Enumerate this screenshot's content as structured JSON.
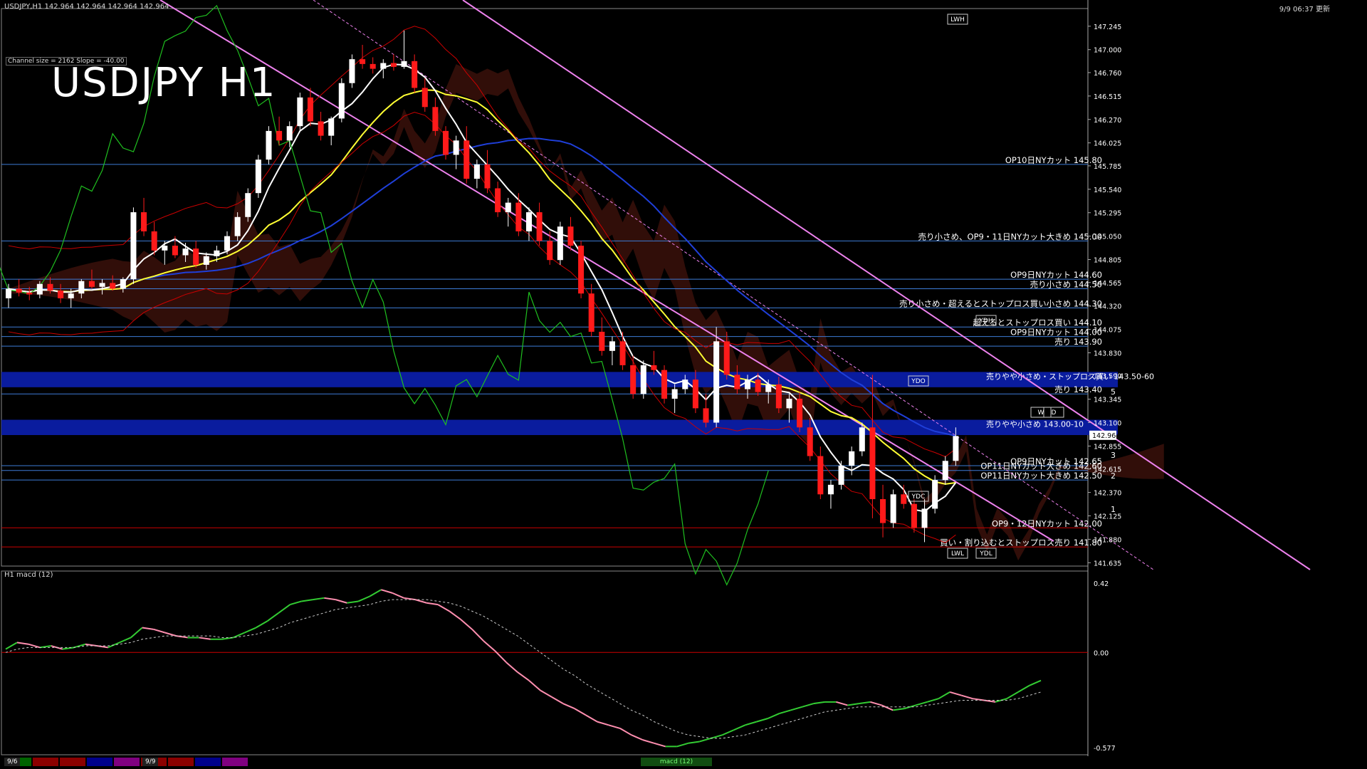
{
  "header": {
    "symbol_info": "USDJPY,H1  142.964 142.964 142.964 142.964",
    "datetime": "9/9 06:37 更新",
    "title": "USDJPY H1",
    "channel_info": "Channel size = 2162 Slope = -40.00"
  },
  "colors": {
    "background": "#000000",
    "bull": "#ffffff",
    "bear": "#ff1a1a",
    "level_line": "#3d7bd6",
    "zone": "#0a1c9e",
    "channel": "#ee82ee",
    "ma_fast": "#ffffff",
    "ma_mid": "#ffff33",
    "ma_slow": "#1f3fd9",
    "macd_up": "#33cc33",
    "macd_down": "#ff8fb0",
    "signal": "#cccccc"
  },
  "chart_data": {
    "type": "candlestick",
    "price_axis": {
      "ticks": [
        "147.245",
        "147.000",
        "146.760",
        "146.515",
        "146.270",
        "146.025",
        "145.785",
        "145.540",
        "145.295",
        "145.050",
        "144.805",
        "144.565",
        "144.320",
        "144.075",
        "143.830",
        "143.590",
        "143.345",
        "143.100",
        "142.855",
        "142.615",
        "142.370",
        "142.125",
        "141.880",
        "141.635"
      ],
      "ylim": [
        141.6,
        147.4
      ],
      "current_price": "142.964"
    },
    "levels": [
      {
        "label": "OP10日NYカット 145.80",
        "price": 145.8
      },
      {
        "label": "売り小さめ、OP9・11日NYカット大きめ 145.00",
        "price": 145.0
      },
      {
        "label": "OP9日NYカット 144.60",
        "price": 144.6
      },
      {
        "label": "売り小さめ 144.50",
        "price": 144.5
      },
      {
        "label": "売り小さめ・超えるとストップロス買い小さめ 144.30",
        "price": 144.3
      },
      {
        "label": "超えるとストップロス買い 144.10",
        "price": 144.1
      },
      {
        "label": "OP9日NYカット 144.00",
        "price": 144.0
      },
      {
        "label": "売り 143.90",
        "price": 143.9
      },
      {
        "label": "売り 143.40",
        "price": 143.4
      },
      {
        "label": "OP9日NYカット 142.65",
        "price": 142.65
      },
      {
        "label": "OP11日NYカット大きめ 142.60",
        "price": 142.6
      },
      {
        "label": "OP11日NYカット大きめ 142.50",
        "price": 142.5
      },
      {
        "label": "OP9・12日NYカット 142.00",
        "price": 142.0
      },
      {
        "label": "買い・割り込むとストップロス売り 141.80",
        "price": 141.8
      }
    ],
    "zones": [
      {
        "label": "売りやや小さめ・ストップロス買い 143.50-60",
        "low": 143.5,
        "high": 143.6
      },
      {
        "label": "売りやや小さめ 143.00-10",
        "low": 143.0,
        "high": 143.1
      }
    ],
    "projection_labels": [
      "5",
      "3",
      "2",
      "1"
    ],
    "box_labels": [
      "YDO",
      "YDC",
      "YDH",
      "YDL",
      "LWH",
      "LWL",
      "W",
      "D"
    ],
    "candles": [
      [
        144.4,
        144.55,
        144.3,
        144.5
      ],
      [
        144.5,
        144.6,
        144.42,
        144.46
      ],
      [
        144.46,
        144.52,
        144.38,
        144.44
      ],
      [
        144.44,
        144.58,
        144.4,
        144.55
      ],
      [
        144.55,
        144.62,
        144.45,
        144.48
      ],
      [
        144.48,
        144.55,
        144.35,
        144.4
      ],
      [
        144.4,
        144.5,
        144.3,
        144.45
      ],
      [
        144.45,
        144.6,
        144.4,
        144.58
      ],
      [
        144.58,
        144.7,
        144.5,
        144.52
      ],
      [
        144.52,
        144.6,
        144.44,
        144.56
      ],
      [
        144.56,
        144.64,
        144.48,
        144.5
      ],
      [
        144.5,
        144.62,
        144.46,
        144.6
      ],
      [
        144.6,
        145.35,
        144.55,
        145.3
      ],
      [
        145.3,
        145.45,
        145.05,
        145.1
      ],
      [
        145.1,
        145.2,
        144.85,
        144.9
      ],
      [
        144.9,
        145.0,
        144.75,
        144.95
      ],
      [
        144.95,
        145.05,
        144.82,
        144.85
      ],
      [
        144.85,
        144.98,
        144.78,
        144.92
      ],
      [
        144.92,
        145.0,
        144.72,
        144.75
      ],
      [
        144.75,
        144.88,
        144.7,
        144.84
      ],
      [
        144.84,
        144.95,
        144.78,
        144.9
      ],
      [
        144.9,
        145.1,
        144.86,
        145.05
      ],
      [
        145.05,
        145.3,
        145.0,
        145.25
      ],
      [
        145.25,
        145.55,
        145.2,
        145.5
      ],
      [
        145.5,
        145.9,
        145.45,
        145.85
      ],
      [
        145.85,
        146.2,
        145.8,
        146.15
      ],
      [
        146.15,
        146.3,
        146.0,
        146.05
      ],
      [
        146.05,
        146.25,
        145.98,
        146.2
      ],
      [
        146.2,
        146.55,
        146.15,
        146.5
      ],
      [
        146.5,
        146.6,
        146.2,
        146.25
      ],
      [
        146.25,
        146.35,
        146.05,
        146.1
      ],
      [
        146.1,
        146.3,
        146.0,
        146.28
      ],
      [
        146.28,
        146.7,
        146.24,
        146.65
      ],
      [
        146.65,
        146.95,
        146.6,
        146.9
      ],
      [
        146.9,
        147.05,
        146.8,
        146.85
      ],
      [
        146.85,
        146.92,
        146.75,
        146.8
      ],
      [
        146.8,
        146.9,
        146.7,
        146.86
      ],
      [
        146.86,
        146.95,
        146.78,
        146.82
      ],
      [
        146.82,
        147.2,
        146.8,
        146.88
      ],
      [
        146.88,
        146.95,
        146.55,
        146.6
      ],
      [
        146.6,
        146.7,
        146.35,
        146.4
      ],
      [
        146.4,
        146.5,
        146.1,
        146.15
      ],
      [
        146.15,
        146.2,
        145.85,
        145.9
      ],
      [
        145.9,
        146.1,
        145.75,
        146.05
      ],
      [
        146.05,
        146.2,
        145.6,
        145.65
      ],
      [
        145.65,
        145.85,
        145.55,
        145.8
      ],
      [
        145.8,
        145.95,
        145.5,
        145.55
      ],
      [
        145.55,
        145.62,
        145.25,
        145.3
      ],
      [
        145.3,
        145.45,
        145.15,
        145.4
      ],
      [
        145.4,
        145.5,
        145.05,
        145.1
      ],
      [
        145.1,
        145.35,
        145.0,
        145.3
      ],
      [
        145.3,
        145.4,
        144.95,
        145.0
      ],
      [
        145.0,
        145.1,
        144.75,
        144.8
      ],
      [
        144.8,
        145.2,
        144.75,
        145.15
      ],
      [
        145.15,
        145.25,
        144.9,
        144.95
      ],
      [
        144.95,
        145.0,
        144.4,
        144.45
      ],
      [
        144.45,
        144.55,
        144.0,
        144.05
      ],
      [
        144.05,
        144.2,
        143.8,
        143.85
      ],
      [
        143.85,
        144.0,
        143.7,
        143.95
      ],
      [
        143.95,
        144.05,
        143.65,
        143.7
      ],
      [
        143.7,
        143.8,
        143.35,
        143.4
      ],
      [
        143.4,
        143.75,
        143.35,
        143.7
      ],
      [
        143.7,
        143.85,
        143.6,
        143.65
      ],
      [
        143.65,
        143.7,
        143.3,
        143.35
      ],
      [
        143.35,
        143.5,
        143.2,
        143.45
      ],
      [
        143.45,
        143.6,
        143.4,
        143.55
      ],
      [
        143.55,
        143.65,
        143.2,
        143.25
      ],
      [
        143.25,
        143.4,
        143.05,
        143.1
      ],
      [
        143.1,
        144.1,
        143.05,
        143.95
      ],
      [
        143.95,
        144.05,
        143.55,
        143.6
      ],
      [
        143.6,
        143.7,
        143.4,
        143.45
      ],
      [
        143.45,
        143.6,
        143.35,
        143.55
      ],
      [
        143.55,
        143.62,
        143.38,
        143.42
      ],
      [
        143.42,
        143.55,
        143.3,
        143.5
      ],
      [
        143.5,
        143.58,
        143.2,
        143.25
      ],
      [
        143.25,
        143.4,
        143.1,
        143.35
      ],
      [
        143.35,
        143.42,
        143.0,
        143.05
      ],
      [
        143.05,
        143.15,
        142.7,
        142.75
      ],
      [
        142.75,
        142.85,
        142.3,
        142.35
      ],
      [
        142.35,
        142.5,
        142.2,
        142.45
      ],
      [
        142.45,
        142.7,
        142.4,
        142.65
      ],
      [
        142.65,
        142.85,
        142.55,
        142.8
      ],
      [
        142.8,
        143.1,
        142.75,
        143.05
      ],
      [
        143.05,
        143.6,
        142.1,
        142.3
      ],
      [
        142.3,
        142.45,
        141.9,
        142.05
      ],
      [
        142.05,
        142.4,
        142.0,
        142.35
      ],
      [
        142.35,
        142.45,
        142.2,
        142.25
      ],
      [
        142.25,
        142.3,
        141.95,
        142.0
      ],
      [
        142.0,
        142.3,
        141.85,
        142.2
      ],
      [
        142.2,
        142.55,
        142.15,
        142.5
      ],
      [
        142.5,
        142.75,
        142.45,
        142.7
      ],
      [
        142.7,
        143.05,
        142.65,
        142.96
      ]
    ],
    "macd": {
      "label": "H1  macd (12)",
      "axis_ticks": [
        "0.42",
        "0.00",
        "-0.577"
      ],
      "ylim": [
        -0.62,
        0.45
      ],
      "macd": [
        0.02,
        0.06,
        0.05,
        0.03,
        0.04,
        0.02,
        0.03,
        0.05,
        0.04,
        0.03,
        0.06,
        0.09,
        0.15,
        0.14,
        0.12,
        0.1,
        0.09,
        0.09,
        0.08,
        0.08,
        0.09,
        0.12,
        0.15,
        0.19,
        0.24,
        0.29,
        0.31,
        0.32,
        0.33,
        0.32,
        0.3,
        0.31,
        0.34,
        0.38,
        0.36,
        0.33,
        0.32,
        0.3,
        0.29,
        0.25,
        0.2,
        0.14,
        0.07,
        0.01,
        -0.06,
        -0.12,
        -0.17,
        -0.23,
        -0.27,
        -0.31,
        -0.34,
        -0.38,
        -0.42,
        -0.44,
        -0.46,
        -0.5,
        -0.53,
        -0.55,
        -0.57,
        -0.57,
        -0.55,
        -0.54,
        -0.52,
        -0.5,
        -0.47,
        -0.44,
        -0.42,
        -0.4,
        -0.37,
        -0.35,
        -0.33,
        -0.31,
        -0.3,
        -0.3,
        -0.32,
        -0.31,
        -0.3,
        -0.32,
        -0.35,
        -0.34,
        -0.32,
        -0.3,
        -0.28,
        -0.24,
        -0.26,
        -0.28,
        -0.29,
        -0.3,
        -0.28,
        -0.24,
        -0.2,
        -0.17
      ],
      "signal": [
        0.0,
        0.02,
        0.03,
        0.03,
        0.03,
        0.03,
        0.03,
        0.04,
        0.04,
        0.04,
        0.05,
        0.06,
        0.08,
        0.09,
        0.1,
        0.1,
        0.1,
        0.1,
        0.1,
        0.09,
        0.09,
        0.1,
        0.11,
        0.13,
        0.15,
        0.18,
        0.2,
        0.22,
        0.24,
        0.26,
        0.27,
        0.28,
        0.29,
        0.31,
        0.32,
        0.32,
        0.32,
        0.32,
        0.31,
        0.3,
        0.28,
        0.25,
        0.22,
        0.18,
        0.14,
        0.1,
        0.05,
        0.0,
        -0.05,
        -0.1,
        -0.14,
        -0.19,
        -0.23,
        -0.27,
        -0.31,
        -0.35,
        -0.38,
        -0.42,
        -0.45,
        -0.48,
        -0.5,
        -0.51,
        -0.52,
        -0.52,
        -0.51,
        -0.5,
        -0.48,
        -0.46,
        -0.44,
        -0.42,
        -0.4,
        -0.38,
        -0.36,
        -0.35,
        -0.34,
        -0.33,
        -0.33,
        -0.33,
        -0.33,
        -0.33,
        -0.33,
        -0.32,
        -0.31,
        -0.3,
        -0.29,
        -0.29,
        -0.29,
        -0.29,
        -0.29,
        -0.28,
        -0.26,
        -0.24
      ]
    }
  },
  "timeline": {
    "dates": [
      {
        "label": "9/6",
        "color": "#444444"
      },
      {
        "label": "9/9",
        "color": "#444444"
      }
    ],
    "segments": [
      "#006400",
      "#8b0000",
      "#8b0000",
      "#00008b",
      "#800080",
      "#8b0000",
      "#8b0000",
      "#00008b",
      "#800080"
    ],
    "indicator_tab": "macd (12)"
  }
}
